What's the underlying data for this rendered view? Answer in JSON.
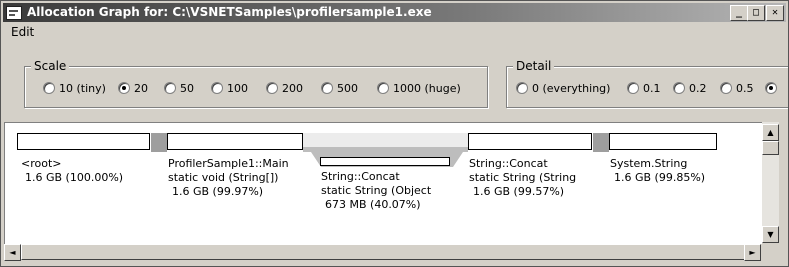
{
  "window": {
    "title": "Allocation Graph for: C:\\VSNETSamples\\profilersample1.exe",
    "controls": {
      "minimize": "_",
      "maximize": "□",
      "close": "✕"
    }
  },
  "menu": {
    "items": [
      "Edit"
    ]
  },
  "scale": {
    "label": "Scale",
    "options": [
      "10 (tiny)",
      "20",
      "50",
      "100",
      "200",
      "500",
      "1000 (huge)"
    ],
    "selected": "20"
  },
  "detail": {
    "label": "Detail",
    "options": [
      "0 (everything)",
      "0.1",
      "0.2",
      "0.5",
      ""
    ],
    "selected": ""
  },
  "graph": {
    "nodes": [
      {
        "name": "<root>",
        "line2": "",
        "stats": "1.6 GB    (100.00%)"
      },
      {
        "name": "ProfilerSample1::Main",
        "line2": "static void (String[])",
        "stats": "1.6 GB    (99.97%)"
      },
      {
        "name": "String::Concat",
        "line2": "static String (Object",
        "stats": "673 MB    (40.07%)"
      },
      {
        "name": "String::Concat",
        "line2": "static String (String",
        "stats": "1.6 GB    (99.57%)"
      },
      {
        "name": "System.String",
        "line2": "",
        "stats": "1.6 GB    (99.85%)"
      }
    ]
  },
  "scrollbars": {
    "up": "▲",
    "down": "▼",
    "left": "◄",
    "right": "►"
  }
}
